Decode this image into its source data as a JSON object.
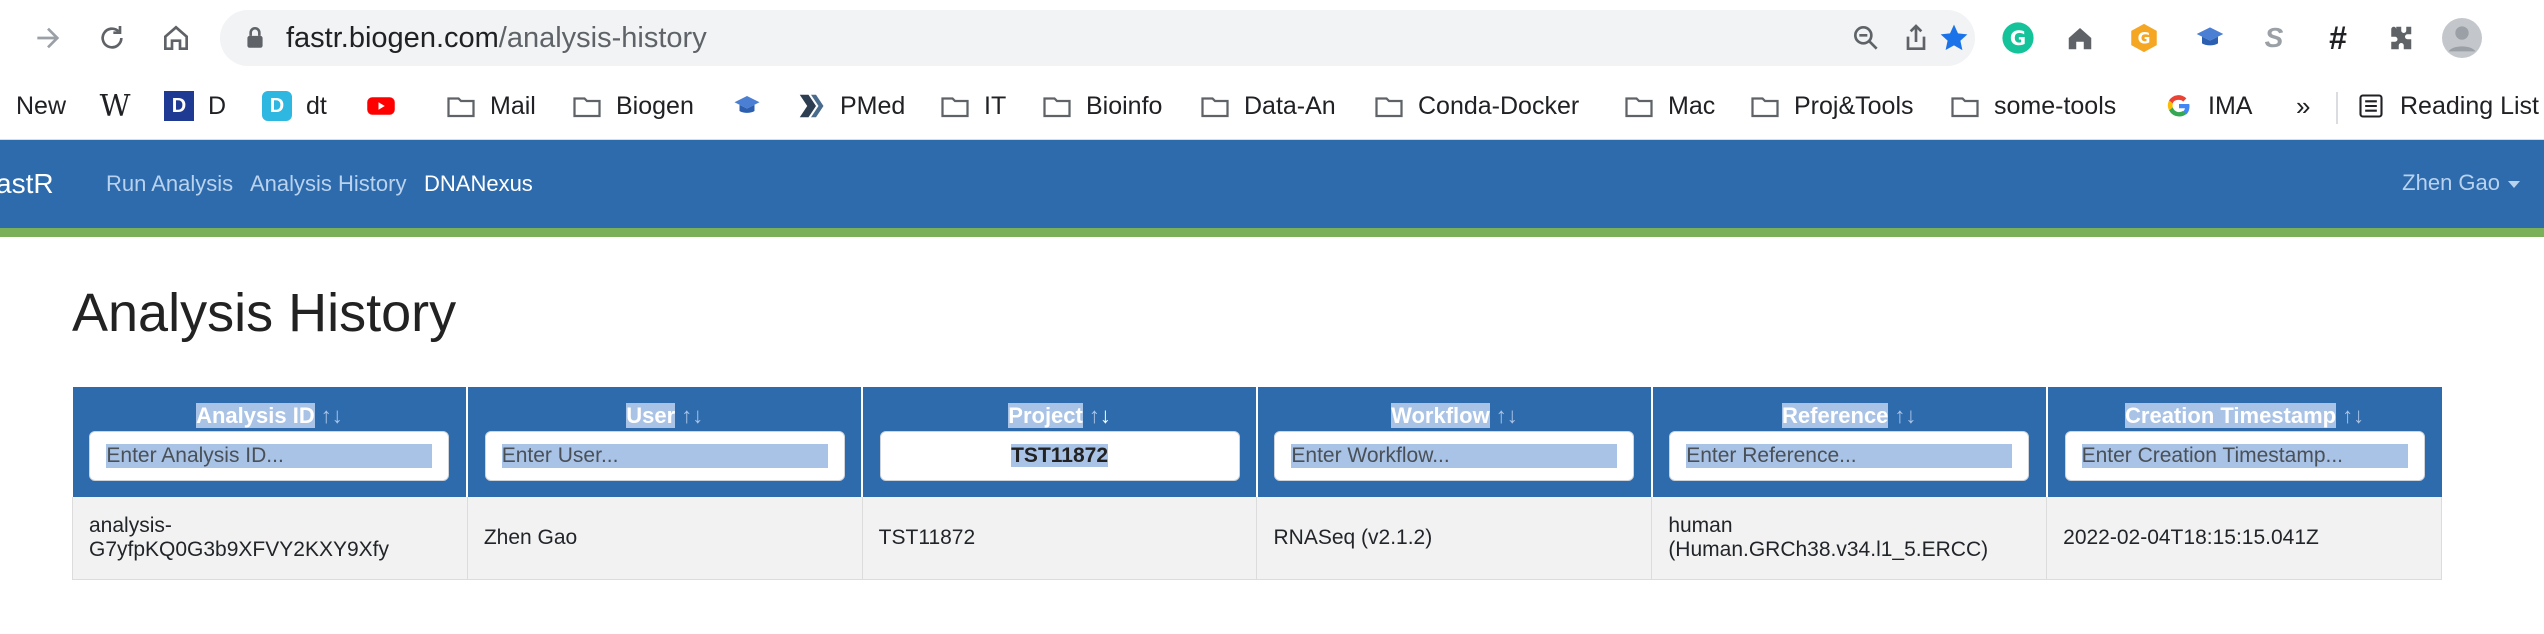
{
  "browser": {
    "url_host": "fastr.biogen.com",
    "url_path": "/analysis-history",
    "bookmarks": [
      {
        "label": "New",
        "icon": "new-tab-icon"
      },
      {
        "label": "",
        "icon": "wikipedia-icon"
      },
      {
        "label": "D",
        "icon": "d-app-icon"
      },
      {
        "label": "dt",
        "icon": "dt-app-icon"
      },
      {
        "label": "",
        "icon": "youtube-icon"
      },
      {
        "label": "Mail",
        "icon": "folder-icon"
      },
      {
        "label": "Biogen",
        "icon": "folder-icon"
      },
      {
        "label": "",
        "icon": "graduation-cap-icon"
      },
      {
        "label": "PMed",
        "icon": "pmed-icon"
      },
      {
        "label": "IT",
        "icon": "folder-icon"
      },
      {
        "label": "Bioinfo",
        "icon": "folder-icon"
      },
      {
        "label": "Data-An",
        "icon": "folder-icon"
      },
      {
        "label": "Conda-Docker",
        "icon": "folder-icon"
      },
      {
        "label": "Mac",
        "icon": "folder-icon"
      },
      {
        "label": "Proj&Tools",
        "icon": "folder-icon"
      },
      {
        "label": "some-tools",
        "icon": "folder-icon"
      },
      {
        "label": "IMA",
        "icon": "google-icon"
      }
    ],
    "overflow_label": "»",
    "reading_list_label": "Reading List"
  },
  "app": {
    "brand": "astR",
    "nav": {
      "run_analysis": "Run Analysis",
      "analysis_history": "Analysis History",
      "dnanexus": "DNANexus"
    },
    "user": "Zhen Gao"
  },
  "page": {
    "title": "Analysis History"
  },
  "table": {
    "columns": [
      {
        "label": "Analysis ID",
        "placeholder": "Enter Analysis ID...",
        "value": "",
        "sort": "none"
      },
      {
        "label": "User",
        "placeholder": "Enter User...",
        "value": "",
        "sort": "none"
      },
      {
        "label": "Project",
        "placeholder": "",
        "value": "TST11872",
        "sort": "desc"
      },
      {
        "label": "Workflow",
        "placeholder": "Enter Workflow...",
        "value": "",
        "sort": "none"
      },
      {
        "label": "Reference",
        "placeholder": "Enter Reference...",
        "value": "",
        "sort": "none"
      },
      {
        "label": "Creation Timestamp",
        "placeholder": "Enter Creation Timestamp...",
        "value": "",
        "sort": "none"
      }
    ],
    "sort_glyph": "↑↓",
    "rows": [
      {
        "analysis_id_line1": "analysis-",
        "analysis_id_line2": "G7yfpKQ0G3b9XFVY2KXY9Xfy",
        "user": "Zhen Gao",
        "project": "TST11872",
        "workflow": "RNASeq (v2.1.2)",
        "reference_line1": "human",
        "reference_line2": "(Human.GRCh38.v34.l1_5.ERCC)",
        "timestamp": "2022-02-04T18:15:15.041Z"
      }
    ]
  },
  "colors": {
    "navbar": "#2d6bad",
    "accent_line": "#7ab05a",
    "selection": "#a9c3e6"
  }
}
